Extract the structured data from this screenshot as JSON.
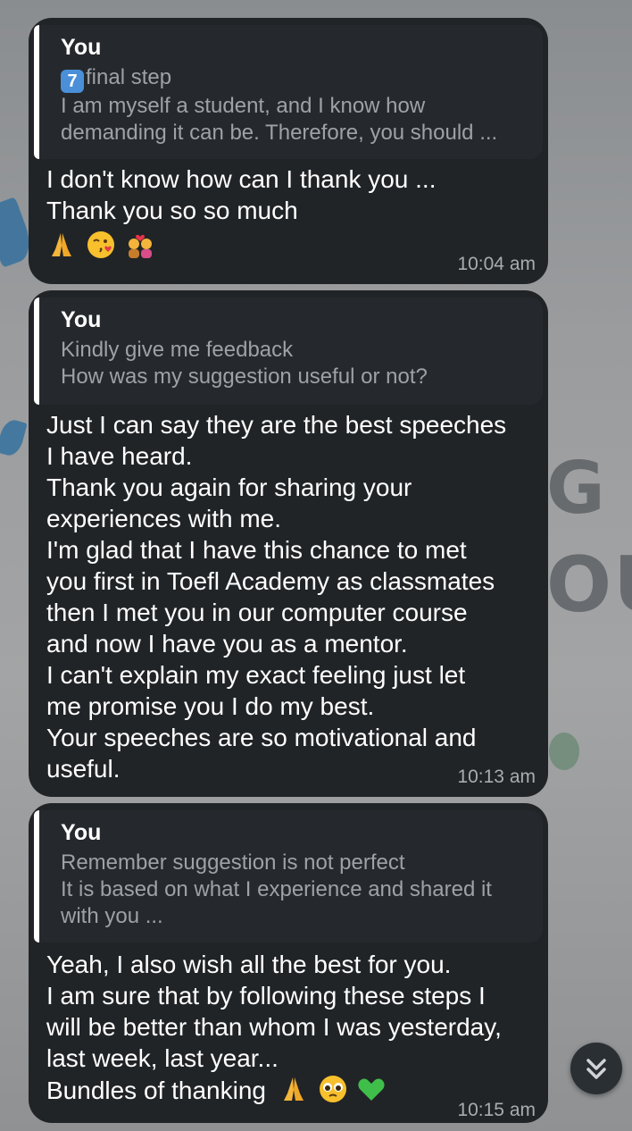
{
  "wallpaper": {
    "letter_g": "G",
    "letters_ou": "OU"
  },
  "messages": [
    {
      "reply_author": "You",
      "reply_badge": "7",
      "reply_lines": [
        "final step",
        "I am myself a student, and I know how",
        "demanding it can be. Therefore, you should ..."
      ],
      "text_lines": [
        "I don't know how can I thank you ...",
        "Thank you so so much"
      ],
      "emojis": [
        "folded-hands-emoji",
        "kiss-face-emoji",
        "couple-heart-emoji"
      ],
      "time": "10:04 am"
    },
    {
      "reply_author": "You",
      "reply_lines": [
        "Kindly give me feedback",
        "How was my suggestion useful or not?"
      ],
      "text_lines": [
        "Just I can say they are the best speeches",
        "I have heard.",
        "Thank you again for sharing your",
        "experiences with me.",
        "I'm glad that I have this chance to met",
        "you first in Toefl Academy as classmates",
        "then I met you in our computer course",
        "and now I have you as a mentor.",
        "I can't explain my exact feeling just let",
        "me promise you I do my best.",
        "Your speeches are so motivational and",
        "useful."
      ],
      "time": "10:13 am"
    },
    {
      "reply_author": "You",
      "reply_lines": [
        "Remember suggestion is not perfect",
        "It is based on what I experience and shared it",
        "with you ..."
      ],
      "text_lines": [
        "Yeah, I also wish all the best for you.",
        "I am sure that by following these steps I",
        "will be better than whom I was yesterday,",
        "last week, last year...",
        "Bundles of thanking"
      ],
      "emojis": [
        "folded-hands-emoji",
        "pleading-face-emoji",
        "green-heart-emoji"
      ],
      "time": "10:15 am"
    }
  ],
  "scroll_button": {
    "icon": "double-chevron-down-icon"
  }
}
